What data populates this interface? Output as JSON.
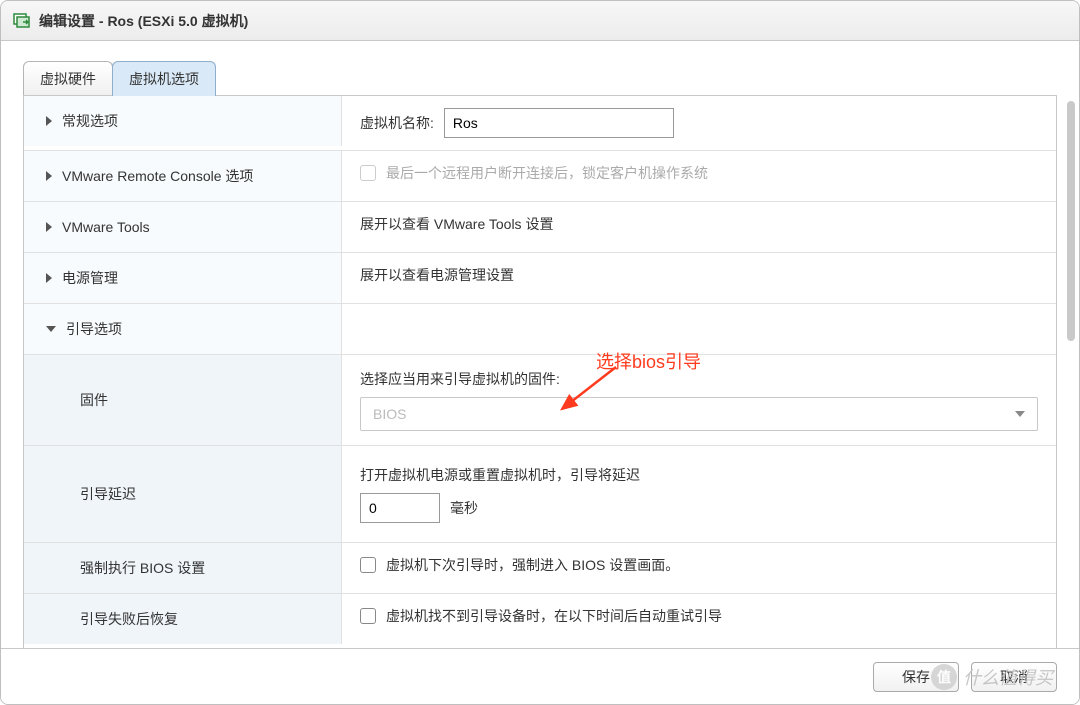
{
  "window": {
    "title": "编辑设置 - Ros (ESXi 5.0 虚拟机)"
  },
  "tabs": {
    "hardware": "虚拟硬件",
    "options": "虚拟机选项"
  },
  "rows": {
    "general": {
      "label": "常规选项",
      "name_label": "虚拟机名称:",
      "name_value": "Ros"
    },
    "remote_console": {
      "label": "VMware Remote Console 选项",
      "desc": "最后一个远程用户断开连接后，锁定客户机操作系统"
    },
    "vmware_tools": {
      "label": "VMware Tools",
      "desc": "展开以查看 VMware Tools 设置"
    },
    "power_mgmt": {
      "label": "电源管理",
      "desc": "展开以查看电源管理设置"
    },
    "boot_options": {
      "label": "引导选项"
    },
    "firmware": {
      "label": "固件",
      "desc": "选择应当用来引导虚拟机的固件:",
      "value": "BIOS"
    },
    "boot_delay": {
      "label": "引导延迟",
      "desc": "打开虚拟机电源或重置虚拟机时，引导将延迟",
      "value": "0",
      "unit": "毫秒"
    },
    "force_bios": {
      "label": "强制执行 BIOS 设置",
      "desc": "虚拟机下次引导时，强制进入 BIOS 设置画面。"
    },
    "boot_fail": {
      "label": "引导失败后恢复",
      "desc": "虚拟机找不到引导设备时，在以下时间后自动重试引导"
    }
  },
  "annotation": "选择bios引导",
  "footer": {
    "save": "保存",
    "cancel": "取消"
  },
  "watermark": {
    "icon": "值",
    "text": "什么值得买"
  }
}
